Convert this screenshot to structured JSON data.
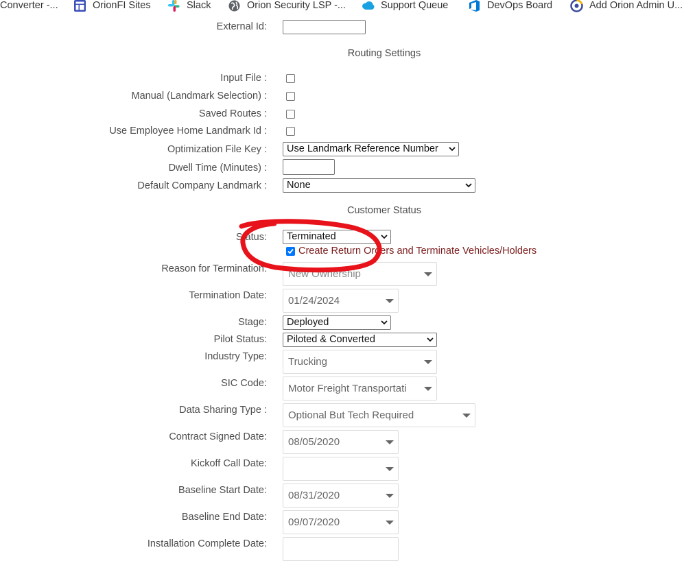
{
  "bookmarks": [
    {
      "label": "Converter -...",
      "icon": "bookmark-icon"
    },
    {
      "label": "OrionFI Sites",
      "icon": "sites-icon"
    },
    {
      "label": "Slack",
      "icon": "slack-icon"
    },
    {
      "label": "Orion Security LSP -...",
      "icon": "globe-icon"
    },
    {
      "label": "Support Queue",
      "icon": "salesforce-cloud-icon"
    },
    {
      "label": "DevOps Board",
      "icon": "azure-devops-icon"
    },
    {
      "label": "Add Orion Admin U...",
      "icon": "chrome-icon"
    }
  ],
  "form": {
    "external_id_label": "External Id:",
    "external_id_value": "",
    "routing_section": "Routing Settings",
    "input_file_label": "Input File :",
    "manual_label": "Manual (Landmark Selection) :",
    "saved_routes_label": "Saved Routes :",
    "employee_home_label": "Use Employee Home Landmark Id :",
    "opt_file_key_label": "Optimization File Key :",
    "opt_file_key_value": "Use Landmark Reference Number",
    "dwell_time_label": "Dwell Time (Minutes) :",
    "dwell_time_value": "",
    "default_landmark_label": "Default Company Landmark :",
    "default_landmark_value": "None",
    "customer_section": "Customer Status",
    "status_label": "Status:",
    "status_value": "Terminated",
    "return_orders_label": "Create Return Orders and Terminate Vehicles/Holders",
    "return_orders_checked": true,
    "reason_label": "Reason for Termination:",
    "reason_value": "New Ownership",
    "termination_date_label": "Termination Date:",
    "termination_date_value": "01/24/2024",
    "stage_label": "Stage:",
    "stage_value": "Deployed",
    "pilot_status_label": "Pilot Status:",
    "pilot_status_value": "Piloted & Converted",
    "industry_label": "Industry Type:",
    "industry_value": "Trucking",
    "sic_label": "SIC Code:",
    "sic_value": "Motor Freight Transportati",
    "data_sharing_label": "Data Sharing Type :",
    "data_sharing_value": "Optional But Tech Required",
    "contract_signed_label": "Contract Signed Date:",
    "contract_signed_value": "08/05/2020",
    "kickoff_label": "Kickoff Call Date:",
    "kickoff_value": "",
    "baseline_start_label": "Baseline Start Date:",
    "baseline_start_value": "08/31/2020",
    "baseline_end_label": "Baseline End Date:",
    "baseline_end_value": "09/07/2020",
    "install_complete_label": "Installation Complete Date:"
  },
  "colors": {
    "annotation": "#e8121a",
    "checkbox_checked": "#0075ff",
    "return_label": "#7a1a1a"
  }
}
